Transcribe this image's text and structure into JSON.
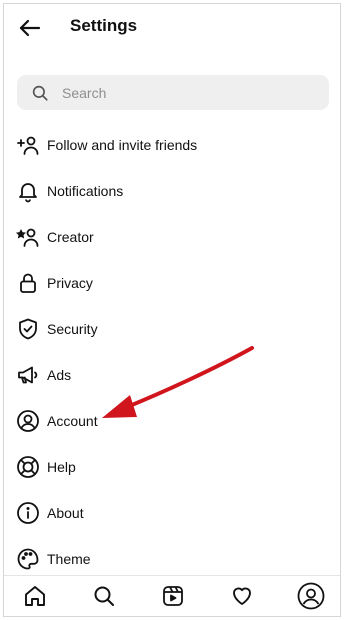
{
  "header": {
    "title": "Settings",
    "back_icon": "back-arrow-icon"
  },
  "search": {
    "placeholder": "Search",
    "icon": "search-icon"
  },
  "menu": [
    {
      "label": "Follow and invite friends",
      "icon": "add-person-icon"
    },
    {
      "label": "Notifications",
      "icon": "bell-icon"
    },
    {
      "label": "Creator",
      "icon": "creator-icon"
    },
    {
      "label": "Privacy",
      "icon": "lock-icon"
    },
    {
      "label": "Security",
      "icon": "shield-icon"
    },
    {
      "label": "Ads",
      "icon": "megaphone-icon"
    },
    {
      "label": "Account",
      "icon": "account-icon"
    },
    {
      "label": "Help",
      "icon": "lifebuoy-icon"
    },
    {
      "label": "About",
      "icon": "info-icon"
    },
    {
      "label": "Theme",
      "icon": "palette-icon"
    }
  ],
  "bottom_nav": [
    "home-icon",
    "search-icon",
    "reels-icon",
    "heart-icon",
    "profile-icon"
  ],
  "colors": {
    "arrow": "#d0161c",
    "text": "#111111",
    "search_bg": "#efefef",
    "placeholder": "#8e8e8e"
  }
}
